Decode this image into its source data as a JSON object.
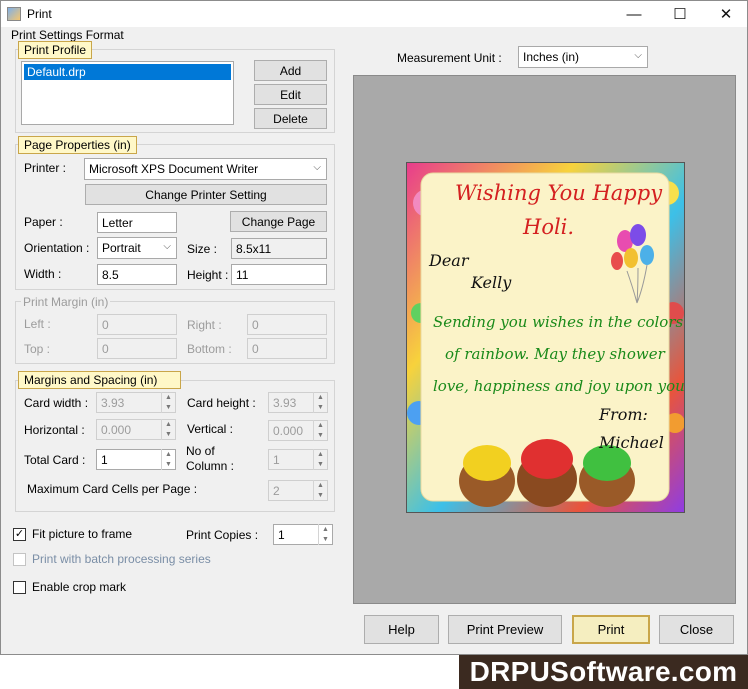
{
  "window": {
    "title": "Print",
    "minimize": "—",
    "maximize": "☐",
    "close": "✕"
  },
  "settings_group": "Print Settings Format",
  "print_profile": {
    "label": "Print Profile",
    "items": [
      "Default.drp"
    ],
    "add": "Add",
    "edit": "Edit",
    "delete": "Delete"
  },
  "page_properties": {
    "label": "Page Properties  (in)",
    "printer_label": "Printer :",
    "printer_value": "Microsoft XPS Document Writer",
    "change_printer": "Change Printer Setting",
    "paper_label": "Paper :",
    "paper_value": "Letter",
    "change_page": "Change Page",
    "orientation_label": "Orientation :",
    "orientation_value": "Portrait",
    "size_label": "Size :",
    "size_value": "8.5x11",
    "width_label": "Width :",
    "width_value": "8.5",
    "height_label": "Height :",
    "height_value": "11"
  },
  "print_margin": {
    "label": "Print Margin (in)",
    "left_label": "Left :",
    "left_value": "0",
    "right_label": "Right :",
    "right_value": "0",
    "top_label": "Top :",
    "top_value": "0",
    "bottom_label": "Bottom :",
    "bottom_value": "0"
  },
  "margins_spacing": {
    "label": "Margins and Spacing  (in)",
    "card_width_label": "Card width :",
    "card_width_value": "3.93",
    "card_height_label": "Card height :",
    "card_height_value": "3.93",
    "horizontal_label": "Horizontal :",
    "horizontal_value": "0.000",
    "vertical_label": "Vertical :",
    "vertical_value": "0.000",
    "total_card_label": "Total Card :",
    "total_card_value": "1",
    "no_of_label": "No of",
    "column_label": "Column :",
    "column_value": "1",
    "max_cells_label": "Maximum Card Cells per Page :",
    "max_cells_value": "2"
  },
  "options": {
    "fit_picture": "Fit picture to frame",
    "fit_checked": "✓",
    "print_copies_label": "Print Copies :",
    "print_copies_value": "1",
    "batch": "Print with batch processing series",
    "crop": "Enable crop mark"
  },
  "measurement": {
    "label": "Measurement Unit :",
    "value": "Inches (in)"
  },
  "card": {
    "line1": "Wishing You Happy",
    "line2": "Holi.",
    "dear": "Dear",
    "name": "Kelly",
    "msg1": "Sending you wishes in the colors",
    "msg2": "of rainbow. May they shower",
    "msg3": "love, happiness and joy upon you!",
    "from": "From:",
    "sender": "Michael"
  },
  "buttons": {
    "help": "Help",
    "preview": "Print Preview",
    "print": "Print",
    "close": "Close"
  },
  "watermark": "DRPUSoftware.com"
}
